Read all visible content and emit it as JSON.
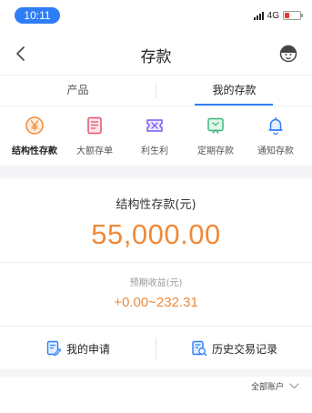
{
  "status_bar": {
    "time": "10:11",
    "network": "4G",
    "battery_level": 0.3,
    "battery_color": "#e53935",
    "time_pill_color": "#2f7df6"
  },
  "nav": {
    "title": "存款",
    "back_icon": "chevron-left-icon",
    "service_icon": "customer-service-icon"
  },
  "tabs": [
    {
      "label": "产品",
      "active": false
    },
    {
      "label": "我的存款",
      "active": true
    }
  ],
  "categories": [
    {
      "label": "结构性存款",
      "icon": "yen-coin-icon",
      "color": "#ef8a3a",
      "active": true
    },
    {
      "label": "大额存单",
      "icon": "certificate-icon",
      "color": "#e2536e",
      "active": false
    },
    {
      "label": "利生利",
      "icon": "interest-ticket-icon",
      "color": "#7b5cf0",
      "active": false
    },
    {
      "label": "定期存款",
      "icon": "fixed-deposit-icon",
      "color": "#3fb67a",
      "active": false
    },
    {
      "label": "通知存款",
      "icon": "bell-icon",
      "color": "#2f7df6",
      "active": false
    }
  ],
  "summary": {
    "title": "结构性存款(元)",
    "amount": "55,000.00",
    "expected_label": "预期收益(元)",
    "expected_range": "+0.00~232.31",
    "amount_color": "#ef8a3a"
  },
  "actions": [
    {
      "label": "我的申请",
      "icon": "application-form-icon"
    },
    {
      "label": "历史交易记录",
      "icon": "transaction-history-icon"
    }
  ],
  "account_filter": {
    "label": "全部账户",
    "icon": "chevron-down-icon"
  }
}
